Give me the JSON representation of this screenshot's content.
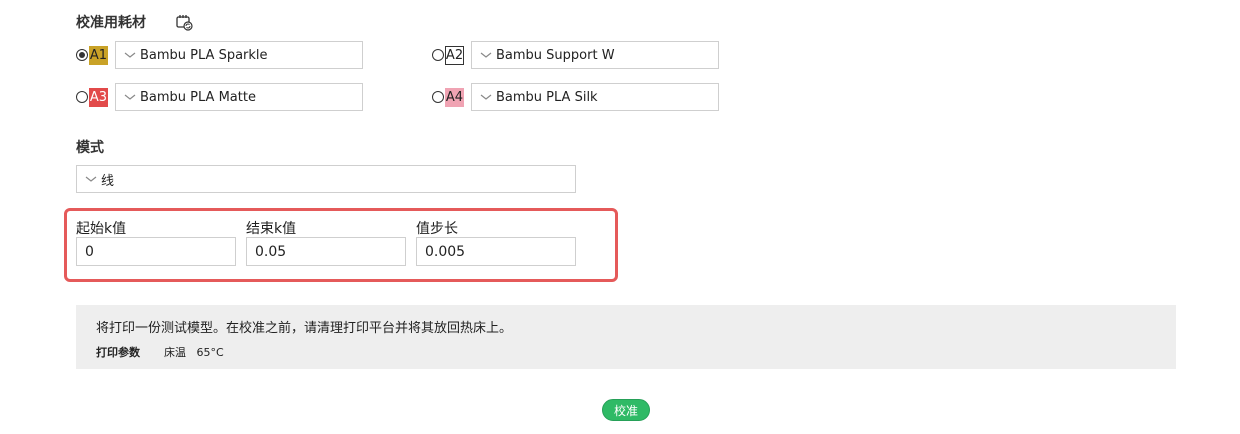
{
  "filament_section": {
    "title": "校准用耗材",
    "slots": [
      {
        "id": "A1",
        "material": "Bambu PLA Sparkle",
        "selected": true,
        "badge_color": "#c9a227",
        "badge_text_color": "#222222"
      },
      {
        "id": "A2",
        "material": "Bambu Support W",
        "selected": false,
        "badge_color": "#ffffff",
        "badge_text_color": "#222222"
      },
      {
        "id": "A3",
        "material": "Bambu PLA Matte",
        "selected": false,
        "badge_color": "#e24a4a",
        "badge_text_color": "#ffffff"
      },
      {
        "id": "A4",
        "material": "Bambu PLA Silk",
        "selected": false,
        "badge_color": "#f0a3b3",
        "badge_text_color": "#222222"
      }
    ]
  },
  "mode_section": {
    "title": "模式",
    "selected": "线"
  },
  "params": {
    "start_k": {
      "label": "起始k值",
      "value": "0"
    },
    "end_k": {
      "label": "结束k值",
      "value": "0.05"
    },
    "step": {
      "label": "值步长",
      "value": "0.005"
    }
  },
  "info": {
    "message": "将打印一份测试模型。在校准之前，请清理打印平台并将其放回热床上。",
    "param_label": "打印参数",
    "param_value": "床温   65°C"
  },
  "actions": {
    "calibrate_label": "校准"
  },
  "colors": {
    "accent_green": "#2fba66",
    "highlight_red": "#e55a5a"
  }
}
